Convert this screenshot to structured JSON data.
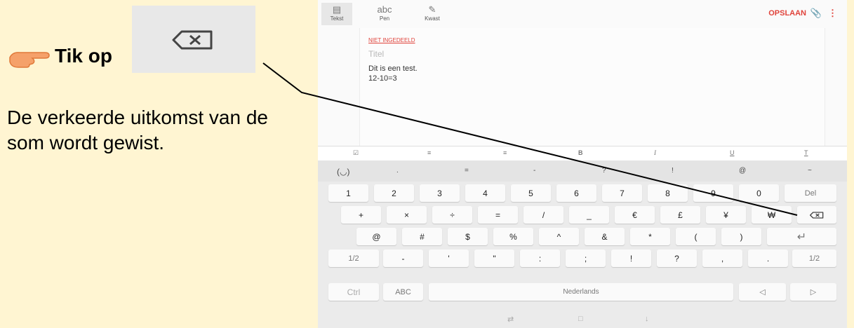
{
  "instruction": {
    "tik_label": "Tik op",
    "explanation": "De verkeerde uitkomst van de som wordt gewist.",
    "hand_icon": "pointing-hand-icon",
    "key_icon": "backspace-icon"
  },
  "toolbar": {
    "modes": [
      {
        "icon": "▤",
        "label": "Tekst"
      },
      {
        "icon": "abc",
        "label": "Pen"
      },
      {
        "icon": "✎",
        "label": "Kwast"
      }
    ],
    "save_label": "OPSLAAN",
    "attach_icon": "paperclip-icon",
    "more_icon": "more-vert-icon",
    "accent": "#e0433b"
  },
  "note": {
    "category": "NIET INGEDEELD",
    "title_placeholder": "Titel",
    "lines": [
      "Dit is een test.",
      "12-10=3"
    ]
  },
  "format_bar": [
    "☑",
    "≡",
    "≡",
    "B",
    "I",
    "U",
    "T"
  ],
  "symbol_row": [
    "(◡)",
    ".",
    "=",
    "-",
    "?",
    "!",
    "@",
    "~"
  ],
  "keys": {
    "row1": [
      "1",
      "2",
      "3",
      "4",
      "5",
      "6",
      "7",
      "8",
      "9",
      "0",
      "Del"
    ],
    "row2": [
      "+",
      "×",
      "÷",
      "=",
      "/",
      "_",
      "€",
      "£",
      "¥",
      "₩",
      "⌫"
    ],
    "row3": [
      "@",
      "#",
      "$",
      "%",
      "^",
      "&",
      "*",
      "(",
      ")",
      "↵"
    ],
    "row4": [
      "1/2",
      "-",
      "'",
      "\"",
      ":",
      ";",
      "!",
      "?",
      ",",
      ".",
      "1/2"
    ],
    "row5": [
      "Ctrl",
      "ABC",
      "Nederlands",
      "◁",
      "▷"
    ]
  },
  "nav_icons": [
    "⇄",
    "□",
    "↓"
  ]
}
